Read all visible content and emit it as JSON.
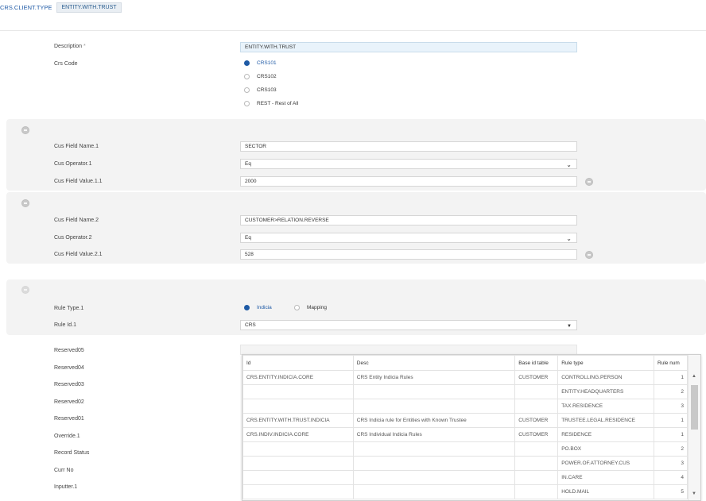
{
  "breadcrumb": {
    "link": "CRS.CLIENT.TYPE",
    "tab": "ENTITY.WITH.TRUST"
  },
  "form": {
    "description_label": "Description",
    "description_value": "ENTITY.WITH.TRUST",
    "crs_code_label": "Crs Code",
    "crs_options": [
      "CRS101",
      "CRS102",
      "CRS103",
      "REST - Rest of All"
    ],
    "crs_selected": "CRS101"
  },
  "group1": {
    "name_label": "Cus Field Name.1",
    "name_value": "SECTOR",
    "op_label": "Cus Operator.1",
    "op_value": "Eq",
    "val_label": "Cus Field Value.1.1",
    "val_value": "2000"
  },
  "group2": {
    "name_label": "Cus Field Name.2",
    "name_value": "CUSTOMER>RELATION.REVERSE",
    "op_label": "Cus Operator.2",
    "op_value": "Eq",
    "val_label": "Cus Field Value.2.1",
    "val_value": "528"
  },
  "rule": {
    "type_label": "Rule Type.1",
    "type_options": [
      "Indicia",
      "Mapping"
    ],
    "type_selected": "Indicia",
    "id_label": "Rule Id.1",
    "id_value": "CRS"
  },
  "other_labels": [
    "Reserved05",
    "Reserved04",
    "Reserved03",
    "Reserved02",
    "Reserved01",
    "Override.1",
    "Record Status",
    "Curr No",
    "Inputter.1"
  ],
  "lookup": {
    "headers": [
      "Id",
      "Desc",
      "Base id table",
      "Rule type",
      "Rule num"
    ],
    "rows": [
      [
        "CRS.ENTITY.INDICIA.CORE",
        "CRS Entity Indicia Rules",
        "CUSTOMER",
        "CONTROLLING.PERSON",
        "1"
      ],
      [
        "",
        "",
        "",
        "ENTITY.HEADQUARTERS",
        "2"
      ],
      [
        "",
        "",
        "",
        "TAX.RESIDENCE",
        "3"
      ],
      [
        "CRS.ENTITY.WITH.TRUST.INDICIA",
        "CRS Indicia rule for Entities with Known Trustee",
        "CUSTOMER",
        "TRUSTEE.LEGAL.RESIDENCE",
        "1"
      ],
      [
        "CRS.INDIV.INDICIA.CORE",
        "CRS Individual Indicia Rules",
        "CUSTOMER",
        "RESIDENCE",
        "1"
      ],
      [
        "",
        "",
        "",
        "PO.BOX",
        "2"
      ],
      [
        "",
        "",
        "",
        "POWER.OF.ATTORNEY.CUS",
        "3"
      ],
      [
        "",
        "",
        "",
        "IN.CARE",
        "4"
      ],
      [
        "",
        "",
        "",
        "HOLD.MAIL",
        "5"
      ]
    ]
  },
  "colors": {
    "accent": "#1e5aa5",
    "panel": "#f3f3f3",
    "highlight": "#e9f3fb"
  }
}
